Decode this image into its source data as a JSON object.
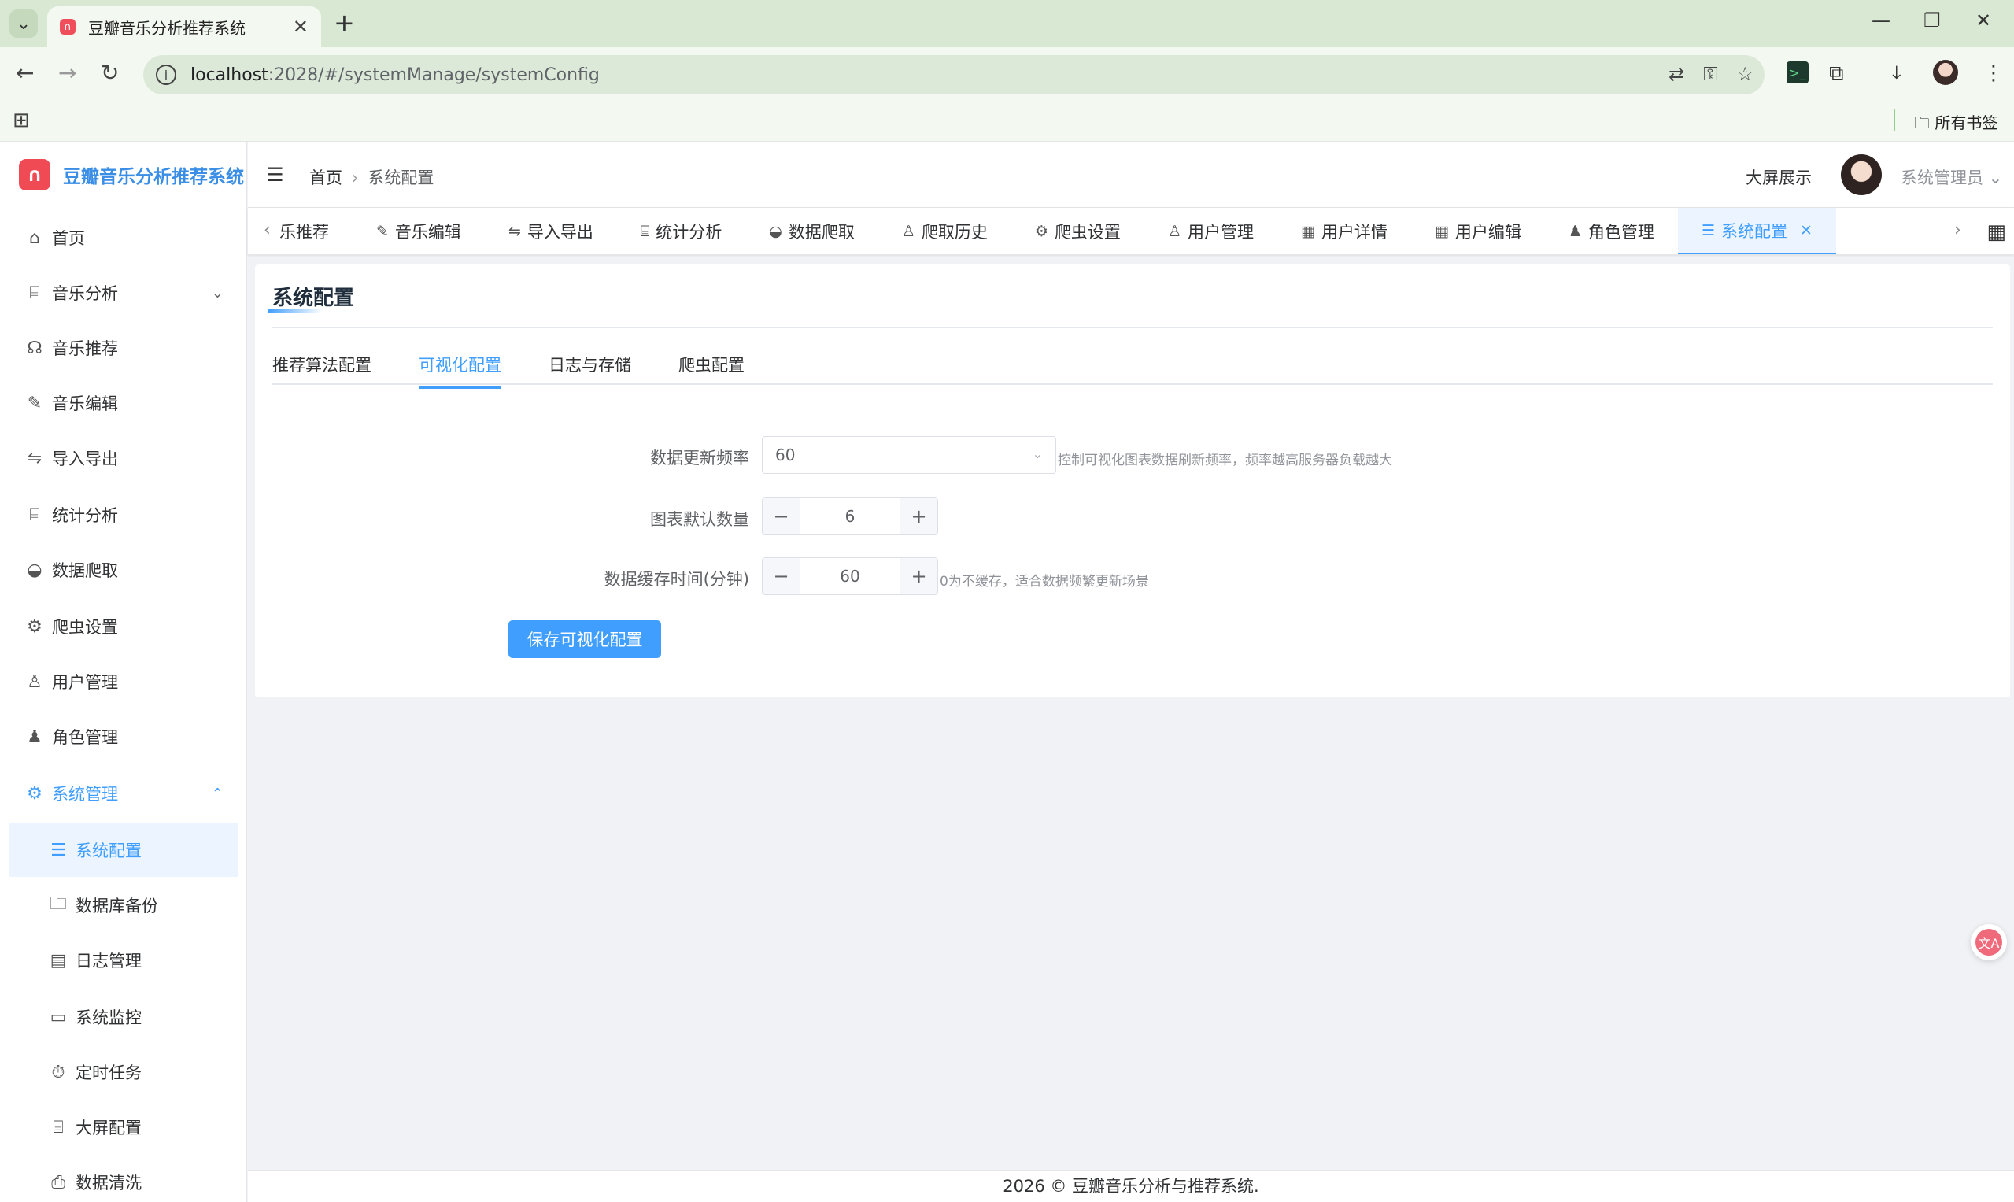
{
  "browser": {
    "tab_title": "豆瓣音乐分析推荐系统",
    "url_host": "localhost",
    "url_rest": ":2028/#/systemManage/systemConfig",
    "bookmarks_all": "所有书签"
  },
  "app": {
    "logo_text": "豆瓣音乐分析推荐系统",
    "sidebar": {
      "items": [
        {
          "label": "首页",
          "icon": "home-icon"
        },
        {
          "label": "音乐分析",
          "icon": "chart-board-icon"
        },
        {
          "label": "音乐推荐",
          "icon": "headphones-icon"
        },
        {
          "label": "音乐编辑",
          "icon": "edit-icon"
        },
        {
          "label": "导入导出",
          "icon": "swap-icon"
        },
        {
          "label": "统计分析",
          "icon": "chart-board-icon"
        },
        {
          "label": "数据爬取",
          "icon": "bowl-icon"
        },
        {
          "label": "爬虫设置",
          "icon": "gear-icon"
        },
        {
          "label": "用户管理",
          "icon": "user-icon"
        },
        {
          "label": "角色管理",
          "icon": "user-filled-icon"
        },
        {
          "label": "系统管理",
          "icon": "gear-icon"
        }
      ],
      "subitems": [
        {
          "label": "系统配置",
          "icon": "sliders-icon"
        },
        {
          "label": "数据库备份",
          "icon": "folder-icon"
        },
        {
          "label": "日志管理",
          "icon": "document-icon"
        },
        {
          "label": "系统监控",
          "icon": "monitor-icon"
        },
        {
          "label": "定时任务",
          "icon": "stopwatch-icon"
        },
        {
          "label": "大屏配置",
          "icon": "chart-board-icon"
        },
        {
          "label": "数据清洗",
          "icon": "printer-icon"
        }
      ]
    },
    "header": {
      "breadcrumb_home": "首页",
      "breadcrumb_current": "系统配置",
      "big_screen": "大屏展示",
      "username": "系统管理员"
    },
    "tags": [
      {
        "label": "乐推荐",
        "icon": "headphones-icon"
      },
      {
        "label": "音乐编辑",
        "icon": "edit-icon"
      },
      {
        "label": "导入导出",
        "icon": "swap-icon"
      },
      {
        "label": "统计分析",
        "icon": "chart-board-icon"
      },
      {
        "label": "数据爬取",
        "icon": "bowl-icon"
      },
      {
        "label": "爬取历史",
        "icon": "user-icon"
      },
      {
        "label": "爬虫设置",
        "icon": "gear-icon"
      },
      {
        "label": "用户管理",
        "icon": "user-icon"
      },
      {
        "label": "用户详情",
        "icon": "grid-icon"
      },
      {
        "label": "用户编辑",
        "icon": "grid-icon"
      },
      {
        "label": "角色管理",
        "icon": "user-filled-icon"
      },
      {
        "label": "系统配置",
        "icon": "sliders-icon"
      }
    ],
    "card": {
      "title": "系统配置",
      "tabs": [
        "推荐算法配置",
        "可视化配置",
        "日志与存储",
        "爬虫配置"
      ],
      "form": {
        "refresh_label": "数据更新频率",
        "refresh_value": "60",
        "refresh_hint": "控制可视化图表数据刷新频率，频率越高服务器负载越大",
        "chart_count_label": "图表默认数量",
        "chart_count_value": "6",
        "cache_label": "数据缓存时间(分钟)",
        "cache_value": "60",
        "cache_hint": "0为不缓存，适合数据频繁更新场景",
        "save_button": "保存可视化配置"
      }
    },
    "footer": "2026 © 豆瓣音乐分析与推荐系统."
  }
}
